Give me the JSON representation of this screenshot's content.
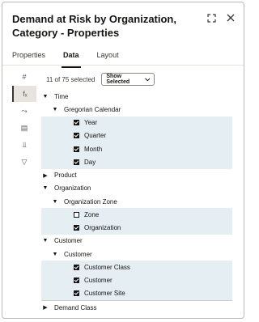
{
  "title": "Demand at Risk by Organization, Category - Properties",
  "tabs": [
    {
      "label": "Properties",
      "active": false
    },
    {
      "label": "Data",
      "active": true
    },
    {
      "label": "Layout",
      "active": false
    }
  ],
  "rail": [
    {
      "icon": "hash-icon",
      "glyph": "#",
      "active": false
    },
    {
      "icon": "fx-icon",
      "glyph": "fₓ",
      "active": true
    },
    {
      "icon": "shuffle-icon",
      "glyph": "⤳",
      "active": false
    },
    {
      "icon": "calendar-icon",
      "glyph": "▤",
      "active": false
    },
    {
      "icon": "hierarchy-icon",
      "glyph": "⫫",
      "active": false
    },
    {
      "icon": "filter-icon",
      "glyph": "▽",
      "active": false
    }
  ],
  "selection": {
    "count_text": "11 of 75 selected",
    "dropdown_value": "Show Selected"
  },
  "tree": [
    {
      "label": "Time",
      "level": 0,
      "type": "group",
      "expanded": true
    },
    {
      "label": "Gregorian Calendar",
      "level": 1,
      "type": "group",
      "expanded": true
    },
    {
      "label": "Year",
      "level": 2,
      "type": "leaf",
      "checked": true
    },
    {
      "label": "Quarter",
      "level": 2,
      "type": "leaf",
      "checked": true
    },
    {
      "label": "Month",
      "level": 2,
      "type": "leaf",
      "checked": true
    },
    {
      "label": "Day",
      "level": 2,
      "type": "leaf",
      "checked": true
    },
    {
      "label": "Product",
      "level": 0,
      "type": "group",
      "expanded": false
    },
    {
      "label": "Organization",
      "level": 0,
      "type": "group",
      "expanded": true
    },
    {
      "label": "Organization Zone",
      "level": 1,
      "type": "group",
      "expanded": true
    },
    {
      "label": "Zone",
      "level": 2,
      "type": "leaf",
      "checked": false
    },
    {
      "label": "Organization",
      "level": 2,
      "type": "leaf",
      "checked": true
    },
    {
      "label": "Customer",
      "level": 0,
      "type": "group",
      "expanded": true
    },
    {
      "label": "Customer",
      "level": 1,
      "type": "group",
      "expanded": true
    },
    {
      "label": "Customer Class",
      "level": 2,
      "type": "leaf",
      "checked": true
    },
    {
      "label": "Customer",
      "level": 2,
      "type": "leaf",
      "checked": true
    },
    {
      "label": "Customer Site",
      "level": 2,
      "type": "leaf",
      "checked": true
    },
    {
      "label": "Demand Class",
      "level": 0,
      "type": "group",
      "expanded": false
    }
  ]
}
